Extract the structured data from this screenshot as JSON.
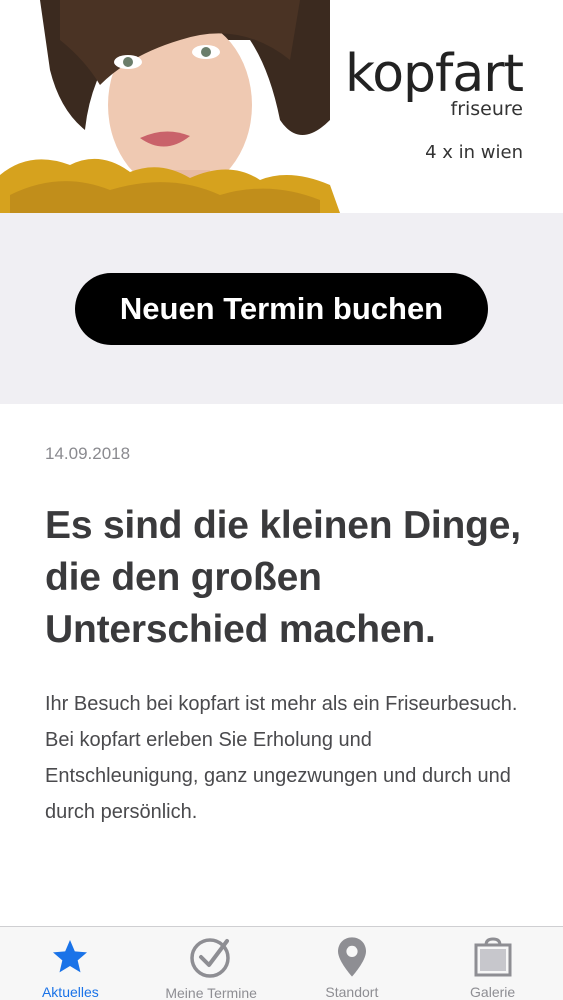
{
  "header": {
    "brand_name": "kopfart",
    "brand_sub": "friseure",
    "brand_tagline": "4 x in wien"
  },
  "cta": {
    "label": "Neuen Termin buchen"
  },
  "article": {
    "date": "14.09.2018",
    "headline": "Es sind die kleinen Dinge, die den großen Unterschied machen.",
    "body": "Ihr Besuch bei kopfart ist mehr als ein Friseurbesuch. Bei kopfart erleben Sie Erholung und Entschleunigung, ganz ungezwungen und durch und durch persönlich."
  },
  "tabbar": {
    "tabs": [
      {
        "label": "Aktuelles",
        "icon": "star-icon",
        "active": true
      },
      {
        "label": "Meine Termine",
        "icon": "check-circle-icon",
        "active": false
      },
      {
        "label": "Standort",
        "icon": "location-pin-icon",
        "active": false
      },
      {
        "label": "Galerie",
        "icon": "gallery-bag-icon",
        "active": false
      }
    ]
  },
  "colors": {
    "active_tab": "#1a73e8",
    "inactive_tab": "#8e8e93",
    "cta_background": "#000000",
    "section_background": "#f0eff3"
  }
}
